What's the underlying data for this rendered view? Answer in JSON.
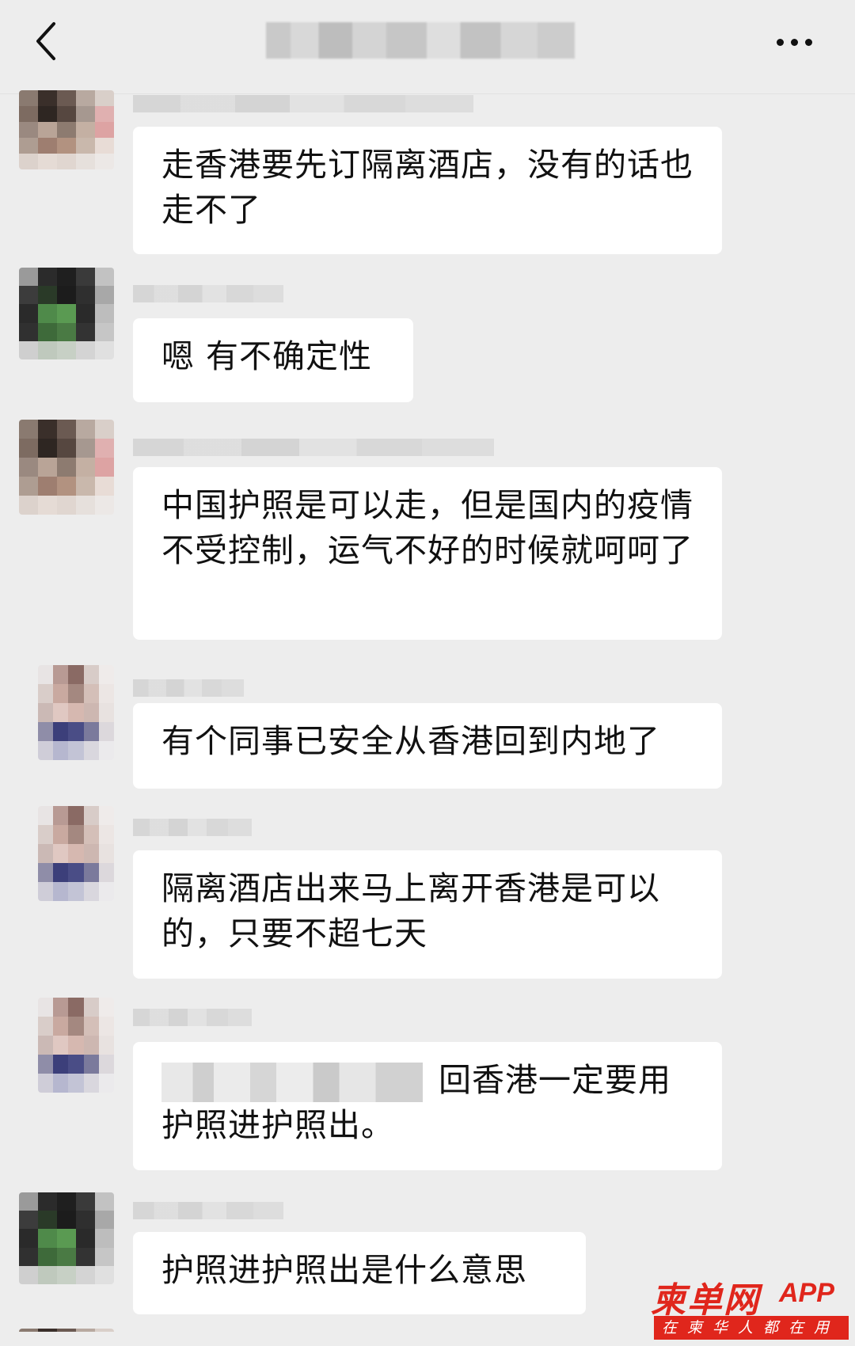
{
  "header": {
    "back_icon": "chevron-left-icon",
    "more_icon": "more-dots-icon"
  },
  "messages": [
    {
      "text": "走香港要先订隔离酒店，没有的话也走不了"
    },
    {
      "text": "嗯 有不确定性"
    },
    {
      "text": "中国护照是可以走，但是国内的疫情不受控制，运气不好的时候就呵呵了"
    },
    {
      "text": "有个同事已安全从香港回到内地了"
    },
    {
      "text": "隔离酒店出来马上离开香港是可以的，只要不超七天"
    },
    {
      "text": "回香港一定要用护照进护照出。"
    },
    {
      "text": "护照进护照出是什么意思"
    }
  ],
  "watermark": {
    "logo": "柬单网",
    "app": "APP",
    "slogan": "在柬华人都在用"
  },
  "colors": {
    "background": "#ededed",
    "bubble": "#ffffff",
    "watermark_red": "#e0261c"
  }
}
